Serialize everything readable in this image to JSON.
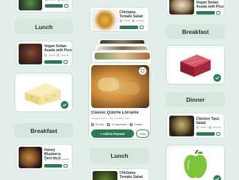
{
  "left_column": {
    "recipe_top": {
      "title": ""
    },
    "label_lunch": "Lunch",
    "recipe_steak": {
      "title": "Vegan Seitan Asada with Pico"
    },
    "label_breakfast": "Breakfast",
    "recipe_pancakes": {
      "title": "Honey Blueberry Pancakes"
    }
  },
  "center_column": {
    "recipe_top": {
      "title": "Chickpea Tomato Salad"
    },
    "featured": {
      "title": "Classic Quiche Lorraine",
      "subtitle": "All-purpose flour, Salt, Unsalted butter",
      "time": "30 mins",
      "ingredients": "13 Ingredients",
      "difficulty": "Shared",
      "add_button": "+ Add to Planner",
      "view_button": "View"
    },
    "label_lunch": "Lunch",
    "recipe_bottom": {
      "title": "Chickpea Tomato Salad"
    }
  },
  "right_column": {
    "recipe_top": {
      "title": "Vegan Seitan Asada with Pico"
    },
    "label_breakfast": "Breakfast",
    "label_dinner": "Dinner",
    "recipe_taco": {
      "title": "Chicken Taco Salad"
    }
  },
  "colors": {
    "background": "#e3eee8",
    "accent": "#2f7a55",
    "pill": "#d6e8de"
  }
}
